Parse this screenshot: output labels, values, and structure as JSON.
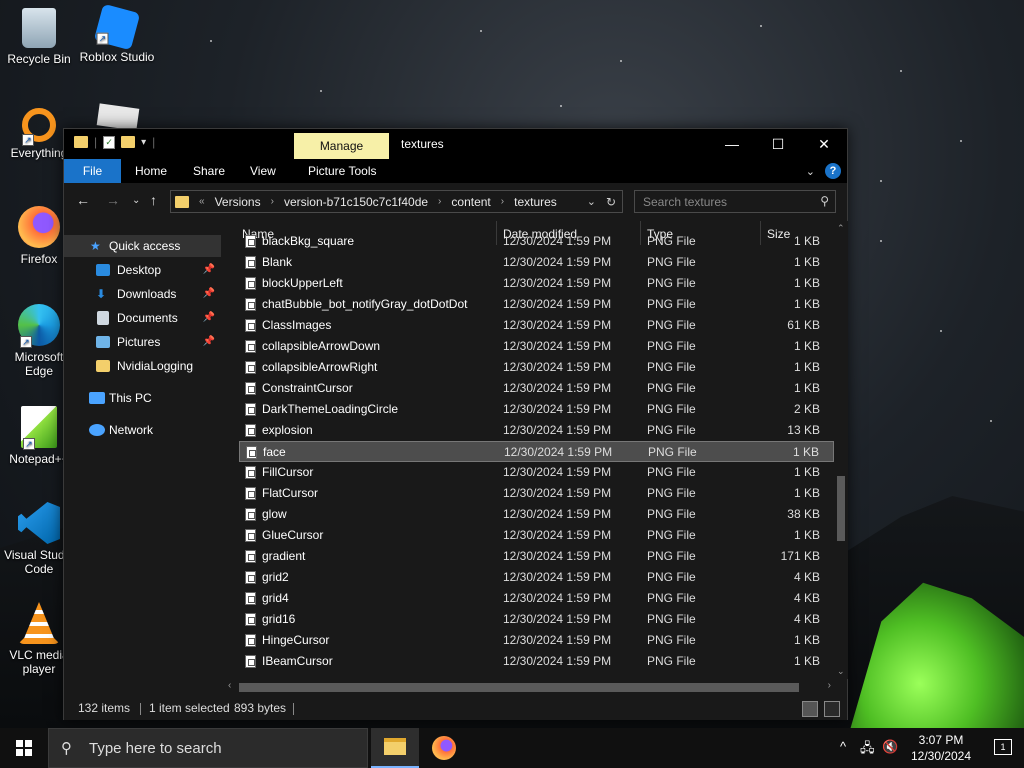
{
  "desktop": {
    "icons": [
      {
        "label": "Recycle Bin",
        "icon": "recycle-bin-icon"
      },
      {
        "label": "Roblox Studio",
        "icon": "roblox-studio-icon"
      },
      {
        "label": "Everything",
        "icon": "everything-search-icon"
      },
      {
        "label": "Firefox",
        "icon": "firefox-icon"
      },
      {
        "label": "Microsoft Edge",
        "icon": "edge-icon"
      },
      {
        "label": "Notepad++",
        "icon": "notepadpp-icon"
      },
      {
        "label": "Visual Studio Code",
        "icon": "vscode-icon"
      },
      {
        "label": "VLC media player",
        "icon": "vlc-icon"
      }
    ]
  },
  "explorer": {
    "manage_tab": "Manage",
    "title": "textures",
    "ribbon_tabs": [
      "File",
      "Home",
      "Share",
      "View",
      "Picture Tools"
    ],
    "address": {
      "overflow": "«",
      "crumbs": [
        "Versions",
        "version-b71c150c7c1f40de",
        "content",
        "textures"
      ]
    },
    "search_placeholder": "Search textures",
    "nav": {
      "quick_access": "Quick access",
      "pinned": [
        "Desktop",
        "Downloads",
        "Documents",
        "Pictures"
      ],
      "other": [
        "NvidiaLogging"
      ],
      "this_pc": "This PC",
      "network": "Network"
    },
    "columns": {
      "name": "Name",
      "date": "Date modified",
      "type": "Type",
      "size": "Size"
    },
    "files": [
      {
        "name": "blackBkg_square",
        "date": "12/30/2024 1:59 PM",
        "type": "PNG File",
        "size": "1 KB"
      },
      {
        "name": "Blank",
        "date": "12/30/2024 1:59 PM",
        "type": "PNG File",
        "size": "1 KB"
      },
      {
        "name": "blockUpperLeft",
        "date": "12/30/2024 1:59 PM",
        "type": "PNG File",
        "size": "1 KB"
      },
      {
        "name": "chatBubble_bot_notifyGray_dotDotDot",
        "date": "12/30/2024 1:59 PM",
        "type": "PNG File",
        "size": "1 KB"
      },
      {
        "name": "ClassImages",
        "date": "12/30/2024 1:59 PM",
        "type": "PNG File",
        "size": "61 KB"
      },
      {
        "name": "collapsibleArrowDown",
        "date": "12/30/2024 1:59 PM",
        "type": "PNG File",
        "size": "1 KB"
      },
      {
        "name": "collapsibleArrowRight",
        "date": "12/30/2024 1:59 PM",
        "type": "PNG File",
        "size": "1 KB"
      },
      {
        "name": "ConstraintCursor",
        "date": "12/30/2024 1:59 PM",
        "type": "PNG File",
        "size": "1 KB"
      },
      {
        "name": "DarkThemeLoadingCircle",
        "date": "12/30/2024 1:59 PM",
        "type": "PNG File",
        "size": "2 KB"
      },
      {
        "name": "explosion",
        "date": "12/30/2024 1:59 PM",
        "type": "PNG File",
        "size": "13 KB"
      },
      {
        "name": "face",
        "date": "12/30/2024 1:59 PM",
        "type": "PNG File",
        "size": "1 KB",
        "selected": true
      },
      {
        "name": "FillCursor",
        "date": "12/30/2024 1:59 PM",
        "type": "PNG File",
        "size": "1 KB"
      },
      {
        "name": "FlatCursor",
        "date": "12/30/2024 1:59 PM",
        "type": "PNG File",
        "size": "1 KB"
      },
      {
        "name": "glow",
        "date": "12/30/2024 1:59 PM",
        "type": "PNG File",
        "size": "38 KB"
      },
      {
        "name": "GlueCursor",
        "date": "12/30/2024 1:59 PM",
        "type": "PNG File",
        "size": "1 KB"
      },
      {
        "name": "gradient",
        "date": "12/30/2024 1:59 PM",
        "type": "PNG File",
        "size": "171 KB"
      },
      {
        "name": "grid2",
        "date": "12/30/2024 1:59 PM",
        "type": "PNG File",
        "size": "4 KB"
      },
      {
        "name": "grid4",
        "date": "12/30/2024 1:59 PM",
        "type": "PNG File",
        "size": "4 KB"
      },
      {
        "name": "grid16",
        "date": "12/30/2024 1:59 PM",
        "type": "PNG File",
        "size": "4 KB"
      },
      {
        "name": "HingeCursor",
        "date": "12/30/2024 1:59 PM",
        "type": "PNG File",
        "size": "1 KB"
      },
      {
        "name": "IBeamCursor",
        "date": "12/30/2024 1:59 PM",
        "type": "PNG File",
        "size": "1 KB"
      }
    ],
    "status": {
      "count": "132 items",
      "selection": "1 item selected",
      "size": "893 bytes"
    }
  },
  "taskbar": {
    "search_placeholder": "Type here to search",
    "time": "3:07 PM",
    "date": "12/30/2024",
    "notification_count": "1"
  },
  "colors": {
    "accent": "#1a73c9",
    "manage_tab": "#f7f0a8",
    "folder": "#f3cf6b"
  }
}
